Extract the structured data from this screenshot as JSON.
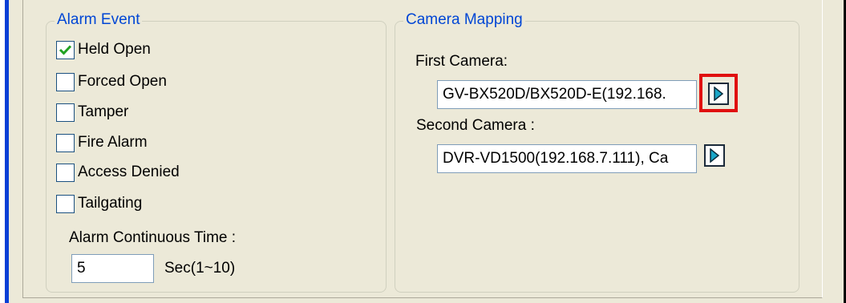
{
  "alarm_event": {
    "title": "Alarm Event",
    "items": [
      {
        "label": "Held Open",
        "checked": true
      },
      {
        "label": "Forced Open",
        "checked": false
      },
      {
        "label": "Tamper",
        "checked": false
      },
      {
        "label": "Fire Alarm",
        "checked": false
      },
      {
        "label": "Access Denied",
        "checked": false
      },
      {
        "label": "Tailgating",
        "checked": false
      }
    ],
    "continuous_time": {
      "label": "Alarm Continuous Time :",
      "value": "5",
      "unit": "Sec(1~10)"
    }
  },
  "camera_mapping": {
    "title": "Camera Mapping",
    "first_camera": {
      "label": "First Camera:",
      "value": "GV-BX520D/BX520D-E(192.168."
    },
    "second_camera": {
      "label": "Second Camera :",
      "value": "DVR-VD1500(192.168.7.111), Ca"
    }
  },
  "colors": {
    "group_title": "#0046d5",
    "highlight": "#e01010",
    "play_arrow": "#1aa6c8"
  },
  "icons": [
    "checkmark-icon",
    "play-arrow-icon"
  ]
}
